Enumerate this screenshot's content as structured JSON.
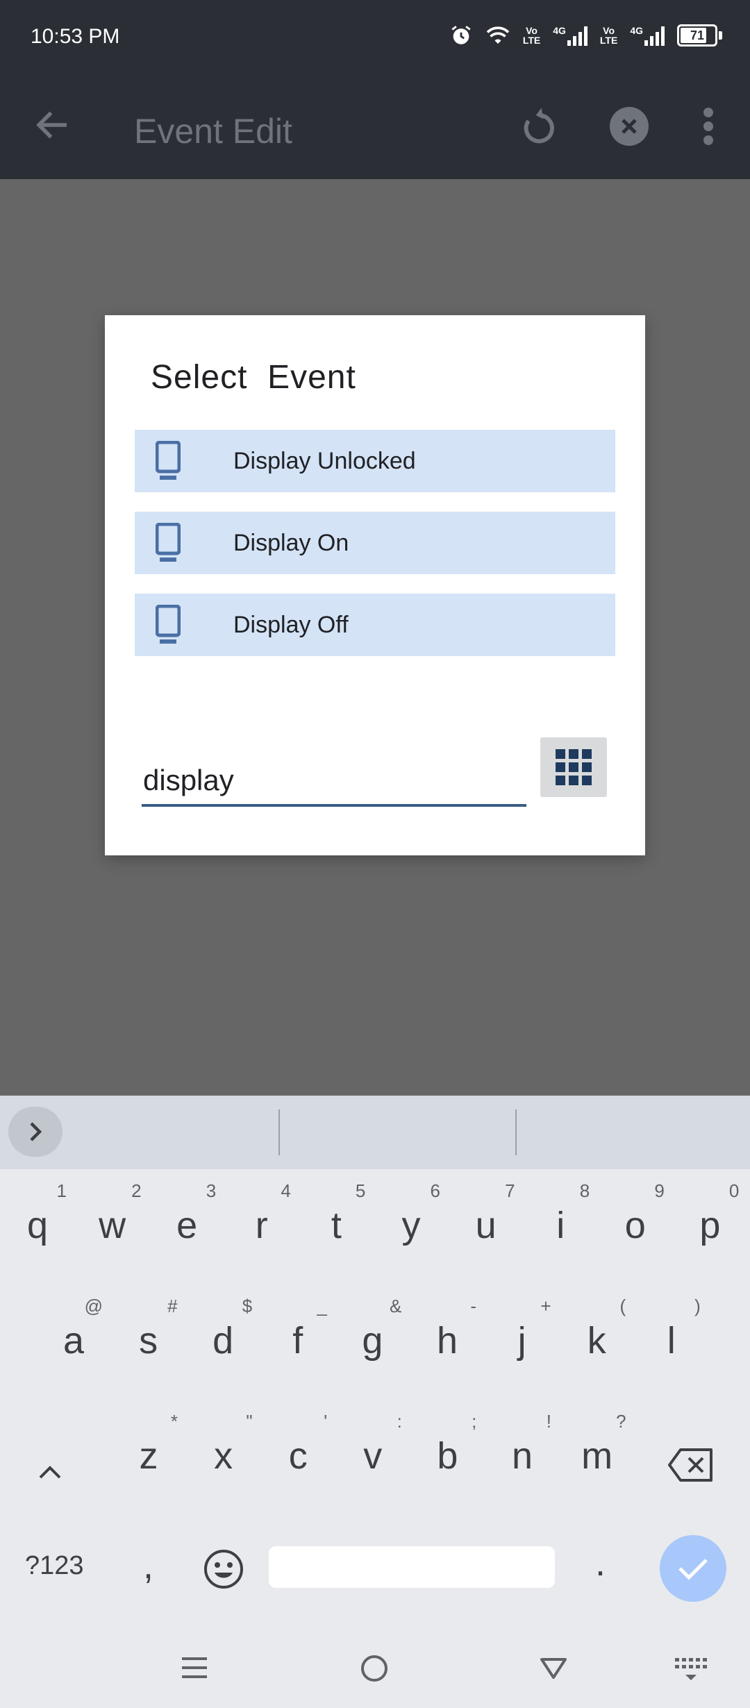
{
  "status_bar": {
    "time": "10:53 PM",
    "network1": "Vo\nLTE",
    "network_type1": "4G",
    "network2": "Vo\nLTE",
    "network_type2": "4G",
    "battery": "71",
    "battery_level": 0.71
  },
  "app_bar": {
    "title": "Event Edit"
  },
  "dialog": {
    "title": "Select  Event",
    "events": [
      {
        "label": "Display Unlocked"
      },
      {
        "label": "Display On"
      },
      {
        "label": "Display Off"
      }
    ],
    "search_value": "display"
  },
  "keyboard": {
    "row1": [
      {
        "k": "q",
        "h": "1"
      },
      {
        "k": "w",
        "h": "2"
      },
      {
        "k": "e",
        "h": "3"
      },
      {
        "k": "r",
        "h": "4"
      },
      {
        "k": "t",
        "h": "5"
      },
      {
        "k": "y",
        "h": "6"
      },
      {
        "k": "u",
        "h": "7"
      },
      {
        "k": "i",
        "h": "8"
      },
      {
        "k": "o",
        "h": "9"
      },
      {
        "k": "p",
        "h": "0"
      }
    ],
    "row2": [
      {
        "k": "a",
        "h": "@"
      },
      {
        "k": "s",
        "h": "#"
      },
      {
        "k": "d",
        "h": "$"
      },
      {
        "k": "f",
        "h": "_"
      },
      {
        "k": "g",
        "h": "&"
      },
      {
        "k": "h",
        "h": "-"
      },
      {
        "k": "j",
        "h": "+"
      },
      {
        "k": "k",
        "h": "("
      },
      {
        "k": "l",
        "h": ")"
      }
    ],
    "row3": [
      {
        "k": "z",
        "h": "*"
      },
      {
        "k": "x",
        "h": "\""
      },
      {
        "k": "c",
        "h": "'"
      },
      {
        "k": "v",
        "h": ":"
      },
      {
        "k": "b",
        "h": ";"
      },
      {
        "k": "n",
        "h": "!"
      },
      {
        "k": "m",
        "h": "?"
      }
    ],
    "symbols_label": "?123",
    "comma": ",",
    "period": "."
  }
}
